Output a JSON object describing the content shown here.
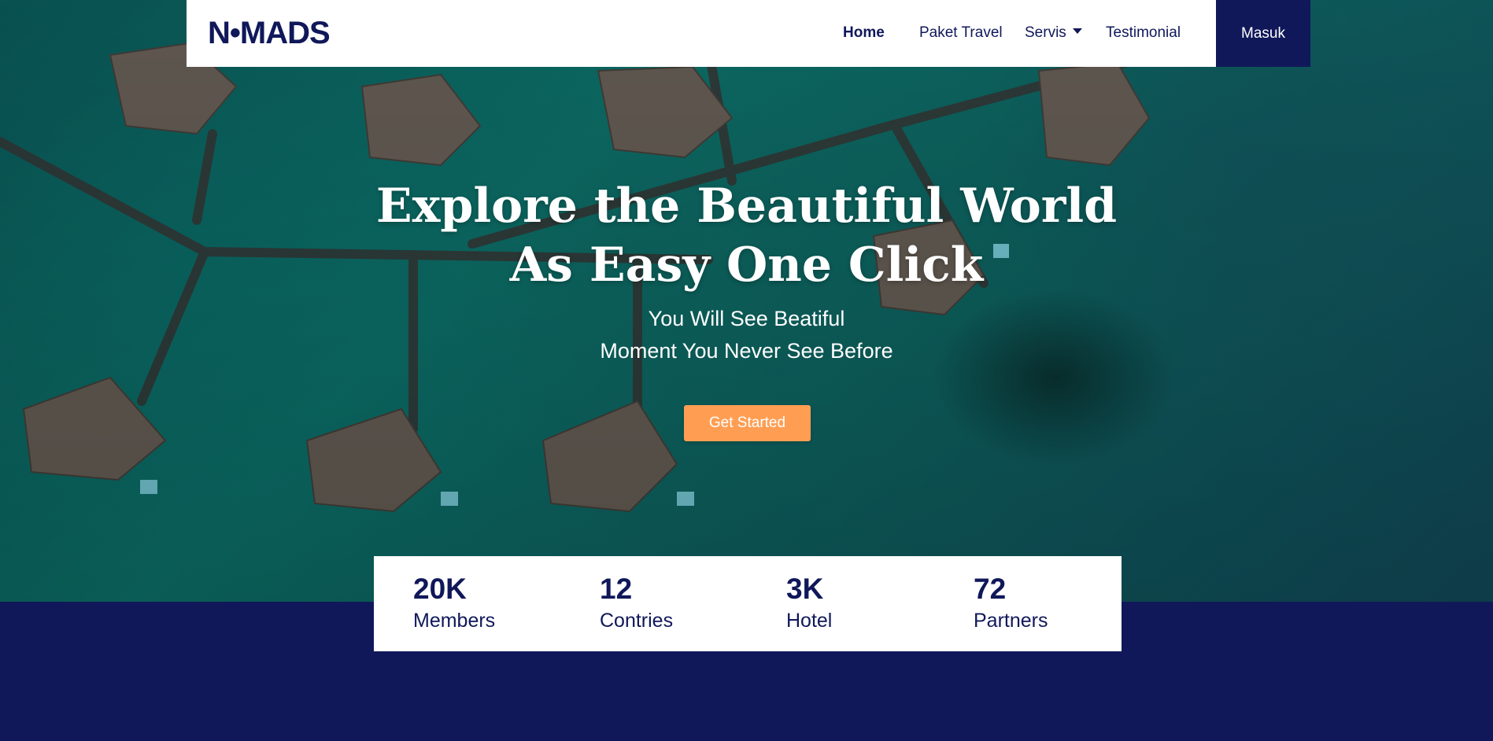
{
  "brand": {
    "logo_text": "N•MADS"
  },
  "nav": {
    "items": [
      {
        "label": "Home",
        "active": true
      },
      {
        "label": "Paket Travel",
        "active": false
      },
      {
        "label": "Servis",
        "active": false,
        "dropdown": true
      },
      {
        "label": "Testimonial",
        "active": false
      }
    ],
    "login_label": "Masuk"
  },
  "hero": {
    "title_line1": "Explore the Beautiful World",
    "title_line2": "As Easy One Click",
    "subtitle_line1": "You Will See Beatiful",
    "subtitle_line2": "Moment You Never See Before",
    "cta_label": "Get Started"
  },
  "stats": [
    {
      "value": "20K",
      "label": "Members"
    },
    {
      "value": "12",
      "label": "Contries"
    },
    {
      "value": "3K",
      "label": "Hotel"
    },
    {
      "value": "72",
      "label": "Partners"
    }
  ],
  "colors": {
    "primary": "#10185a",
    "accent": "#ff9e53",
    "surface": "#ffffff"
  }
}
